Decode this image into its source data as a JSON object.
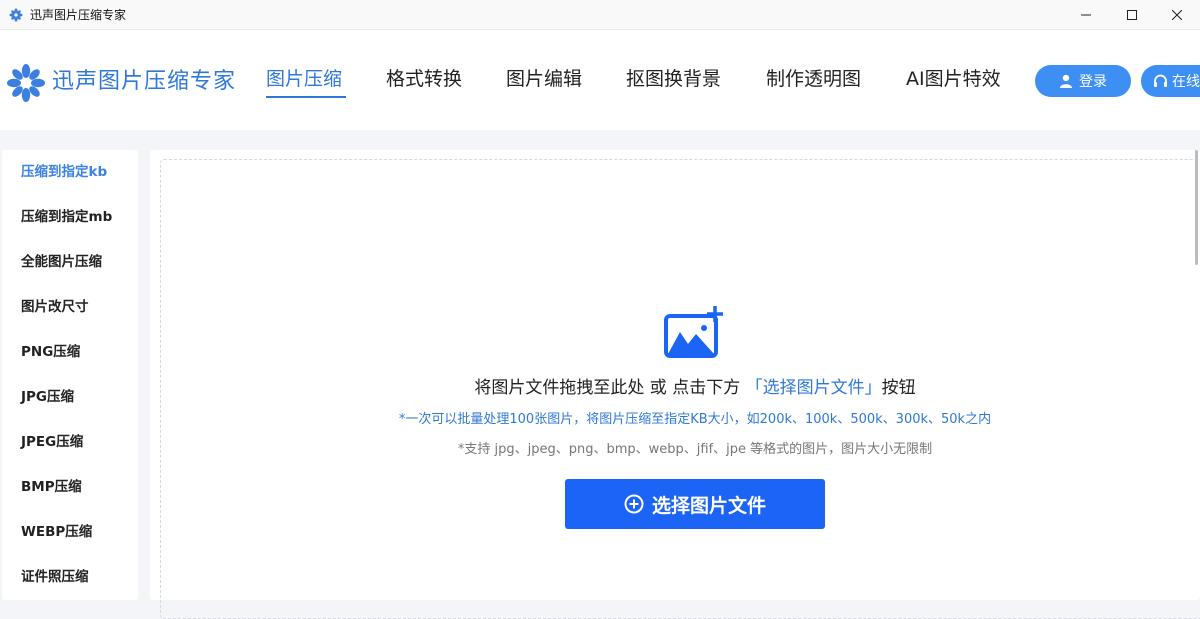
{
  "window": {
    "title": "迅声图片压缩专家"
  },
  "header": {
    "logo_text": "迅声图片压缩专家",
    "nav": [
      {
        "label": "图片压缩"
      },
      {
        "label": "格式转换"
      },
      {
        "label": "图片编辑"
      },
      {
        "label": "抠图换背景"
      },
      {
        "label": "制作透明图"
      },
      {
        "label": "AI图片特效"
      }
    ],
    "login_label": "登录",
    "online_label": "在线"
  },
  "sidebar": {
    "items": [
      {
        "label": "压缩到指定kb"
      },
      {
        "label": "压缩到指定mb"
      },
      {
        "label": "全能图片压缩"
      },
      {
        "label": "图片改尺寸"
      },
      {
        "label": "PNG压缩"
      },
      {
        "label": "JPG压缩"
      },
      {
        "label": "JPEG压缩"
      },
      {
        "label": "BMP压缩"
      },
      {
        "label": "WEBP压缩"
      },
      {
        "label": "证件照压缩"
      }
    ]
  },
  "main": {
    "drop_text_prefix": "将图片文件拖拽至此处 或 点击下方",
    "drop_text_link": "「选择图片文件」",
    "drop_text_suffix": "按钮",
    "hint_batch": "*一次可以批量处理100张图片，将图片压缩至指定KB大小，如200k、100k、500k、300k、50k之内",
    "hint_formats": "*支持 jpg、jpeg、png、bmp、webp、jfif、jpe 等格式的图片，图片大小无限制",
    "select_button_label": "选择图片文件"
  },
  "colors": {
    "accent": "#2f78d8",
    "button_primary": "#1b64f5",
    "pill_button": "#3e8ff3"
  }
}
